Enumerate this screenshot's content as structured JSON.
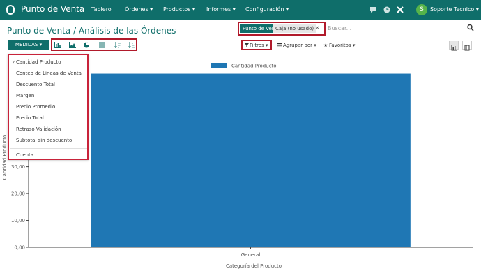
{
  "topbar": {
    "brand": "Punto de Venta",
    "menu": [
      "Tablero",
      "Órdenes ▾",
      "Productos ▾",
      "Informes ▾",
      "Configuración ▾"
    ],
    "user_initial": "S",
    "user_name": "Soporte Tecnico ▾"
  },
  "page": {
    "title": "Punto de Venta / Análisis de las Órdenes"
  },
  "search": {
    "facet_category": "Punto de Venta",
    "facet_value": "Caja (no usado)",
    "facet_remove": "×",
    "placeholder": "Buscar..."
  },
  "toolbar": {
    "measures_label": "MEDIDAS ▾",
    "filters_label": "Filtros ▾",
    "group_by_label": "Agrupar por ▾",
    "favorites_label": "Favoritos ▾"
  },
  "measures_menu": {
    "items": [
      "Cantidad Producto",
      "Conteo de Líneas de Venta",
      "Descuento Total",
      "Margen",
      "Precio Promedio",
      "Precio Total",
      "Retraso Validación",
      "Subtotal sin descuento",
      "Cuenta"
    ],
    "checked": "Cantidad Producto",
    "check_mark": "✓"
  },
  "chart_data": {
    "type": "bar",
    "categories": [
      "General"
    ],
    "series": [
      {
        "name": "Cantidad Producto",
        "values": [
          64.6
        ]
      }
    ],
    "xlabel": "Categoría del Producto",
    "ylabel": "Cantidad Producto",
    "yticks": [
      "0,00",
      "10,00",
      "20,00",
      "30,00"
    ],
    "ylim": [
      0,
      65
    ],
    "legend": "top",
    "bar_color": "#1f77b4",
    "grid": false
  },
  "colors": {
    "brand": "#0f6e6a",
    "highlight": "#b11a2b"
  }
}
